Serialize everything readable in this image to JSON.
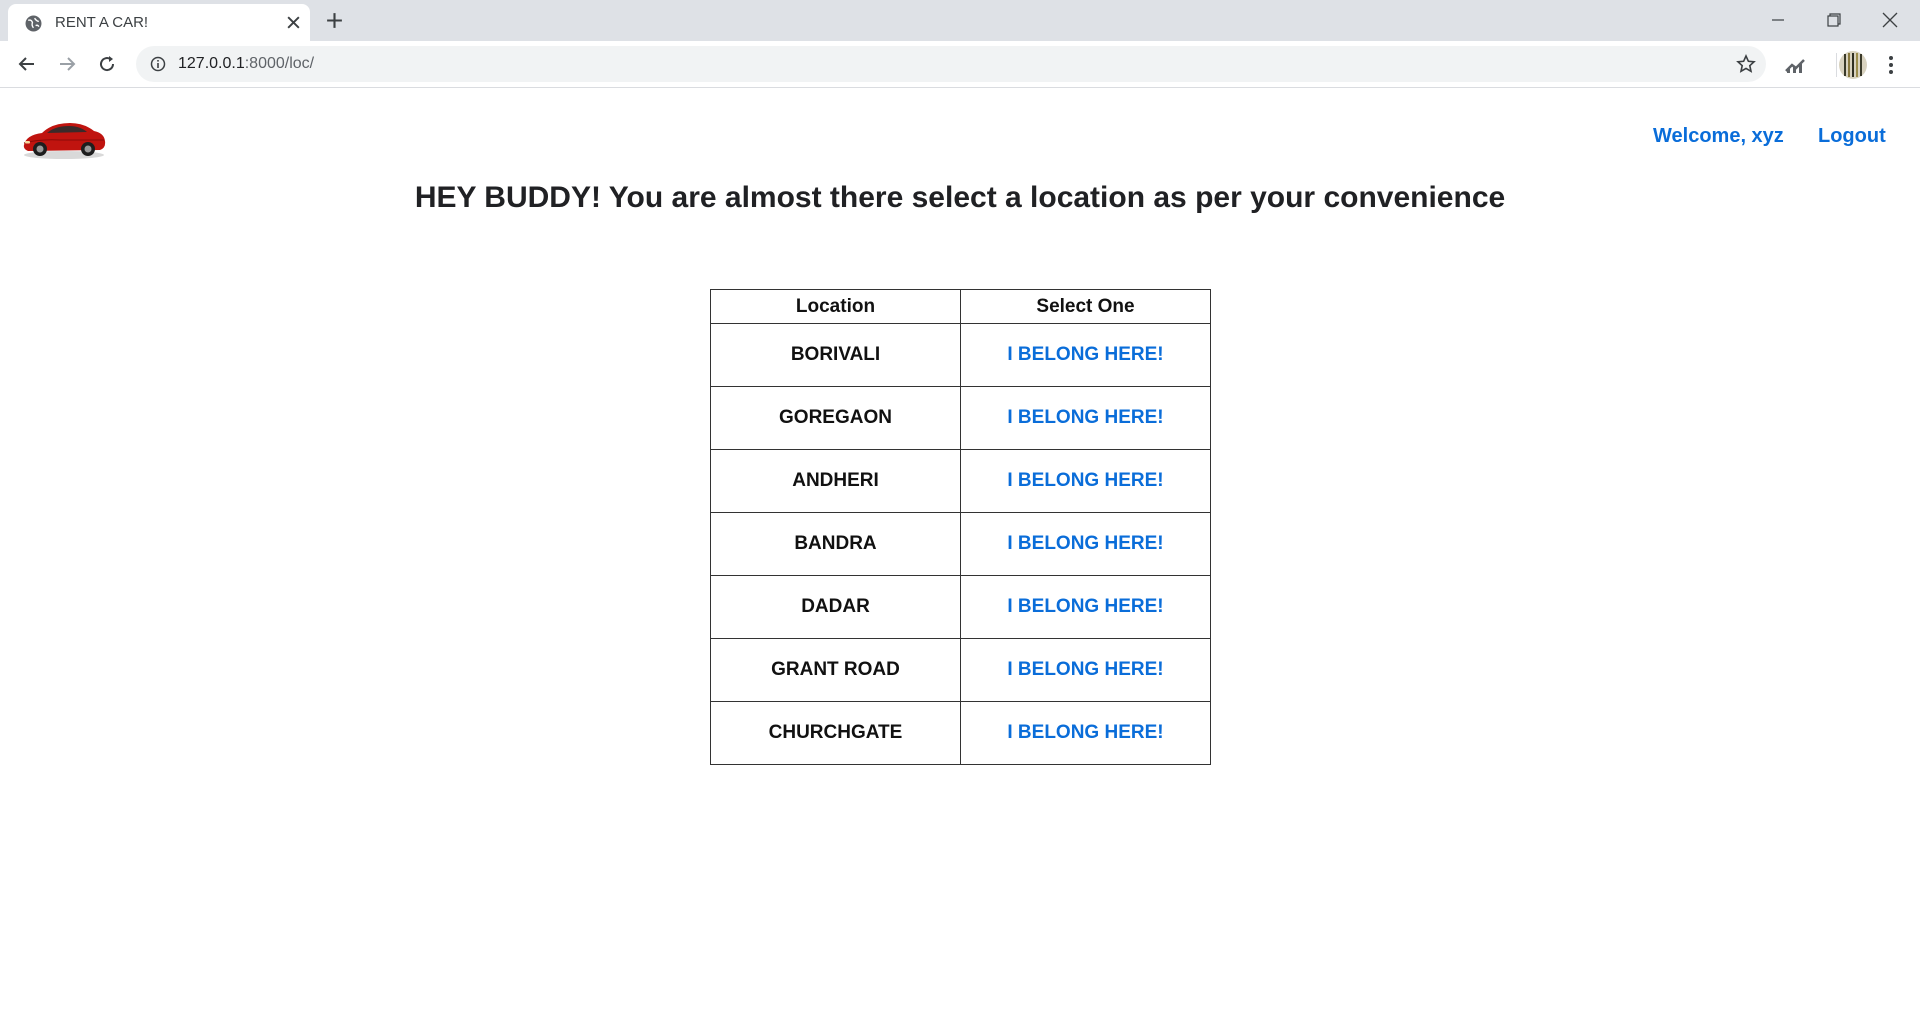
{
  "browser": {
    "tab_title": "RENT A CAR!",
    "url_host": "127.0.0.1",
    "url_path": ":8000/loc/"
  },
  "nav": {
    "welcome": "Welcome, xyz",
    "logout": "Logout"
  },
  "heading": "HEY BUDDY! You are almost there select a location as per your convenience",
  "table": {
    "headers": [
      "Location",
      "Select One"
    ],
    "link_label": "I BELONG HERE!",
    "rows": [
      {
        "location": "BORIVALI",
        "action": "I BELONG HERE!"
      },
      {
        "location": "GOREGAON",
        "action": "I BELONG HERE!"
      },
      {
        "location": "ANDHERI",
        "action": "I BELONG HERE!"
      },
      {
        "location": "BANDRA",
        "action": "I BELONG HERE!"
      },
      {
        "location": "DADAR",
        "action": "I BELONG HERE!"
      },
      {
        "location": "GRANT ROAD",
        "action": "I BELONG HERE!"
      },
      {
        "location": "CHURCHGATE",
        "action": "I BELONG HERE!"
      }
    ]
  },
  "colors": {
    "link": "#0a6dd9",
    "text": "#202124",
    "chrome_bg": "#dee1e6"
  },
  "icons": [
    "globe-icon",
    "close-icon",
    "plus-icon",
    "minimize-icon",
    "maximize-icon",
    "window-close-icon",
    "back-icon",
    "forward-icon",
    "reload-icon",
    "info-icon",
    "star-icon",
    "extension-icon",
    "profile-icon",
    "menu-icon",
    "car-logo-icon"
  ]
}
